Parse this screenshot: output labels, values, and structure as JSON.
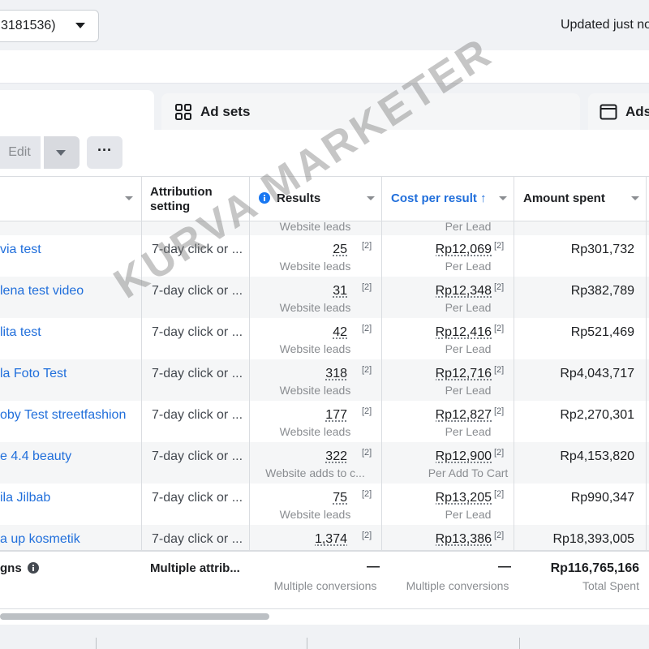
{
  "topbar": {
    "account_label": "3181536)",
    "updated_text": "Updated just no"
  },
  "tabs": {
    "adsets_label": "Ad sets",
    "ads_label": "Ads"
  },
  "toolbar": {
    "edit_label": "Edit",
    "more_label": "···"
  },
  "headers": {
    "attribution": "Attribution setting",
    "results": "Results",
    "cost_per_result": "Cost per result ↑",
    "amount_spent": "Amount spent"
  },
  "top_partial": {
    "res_sub": "Website leads",
    "cost_sub": "Per Lead"
  },
  "rows": [
    {
      "name": "via test",
      "attr": "7-day click or ...",
      "results": "25",
      "res_sup": "[2]",
      "res_sub": "Website leads",
      "cost": "Rp12,069",
      "cost_sup": "[2]",
      "cost_sub": "Per Lead",
      "amount": "Rp301,732"
    },
    {
      "name": "lena test video",
      "attr": "7-day click or ...",
      "results": "31",
      "res_sup": "[2]",
      "res_sub": "Website leads",
      "cost": "Rp12,348",
      "cost_sup": "[2]",
      "cost_sub": "Per Lead",
      "amount": "Rp382,789"
    },
    {
      "name": "lita test",
      "attr": "7-day click or ...",
      "results": "42",
      "res_sup": "[2]",
      "res_sub": "Website leads",
      "cost": "Rp12,416",
      "cost_sup": "[2]",
      "cost_sub": "Per Lead",
      "amount": "Rp521,469"
    },
    {
      "name": "la Foto Test",
      "attr": "7-day click or ...",
      "results": "318",
      "res_sup": "[2]",
      "res_sub": "Website leads",
      "cost": "Rp12,716",
      "cost_sup": "[2]",
      "cost_sub": "Per Lead",
      "amount": "Rp4,043,717"
    },
    {
      "name": "oby Test streetfashion",
      "attr": "7-day click or ...",
      "results": "177",
      "res_sup": "[2]",
      "res_sub": "Website leads",
      "cost": "Rp12,827",
      "cost_sup": "[2]",
      "cost_sub": "Per Lead",
      "amount": "Rp2,270,301"
    },
    {
      "name": "e 4.4 beauty",
      "attr": "7-day click or ...",
      "results": "322",
      "res_sup": "[2]",
      "res_sub": "Website adds to c...",
      "cost": "Rp12,900",
      "cost_sup": "[2]",
      "cost_sub": "Per Add To Cart",
      "amount": "Rp4,153,820"
    },
    {
      "name": "ila Jilbab",
      "attr": "7-day click or ...",
      "results": "75",
      "res_sup": "[2]",
      "res_sub": "Website leads",
      "cost": "Rp13,205",
      "cost_sup": "[2]",
      "cost_sub": "Per Lead",
      "amount": "Rp990,347"
    },
    {
      "name": "a up kosmetik",
      "attr": "7-day click or ...",
      "results": "1,374",
      "res_sup": "[2]",
      "res_sub": "",
      "cost": "Rp13,386",
      "cost_sup": "[2]",
      "cost_sub": "",
      "amount": "Rp18,393,005"
    }
  ],
  "footer": {
    "name": "gns",
    "attr": "Multiple attrib...",
    "results_dash": "—",
    "results_sub": "Multiple conversions",
    "cost_dash": "—",
    "cost_sub": "Multiple conversions",
    "amount": "Rp116,765,166",
    "amount_sub": "Total Spent"
  },
  "watermark": "KURVA MARKETER",
  "colors": {
    "link": "#216fdb",
    "sorted_header": "#216fdb",
    "info_icon": "#1877f2"
  }
}
